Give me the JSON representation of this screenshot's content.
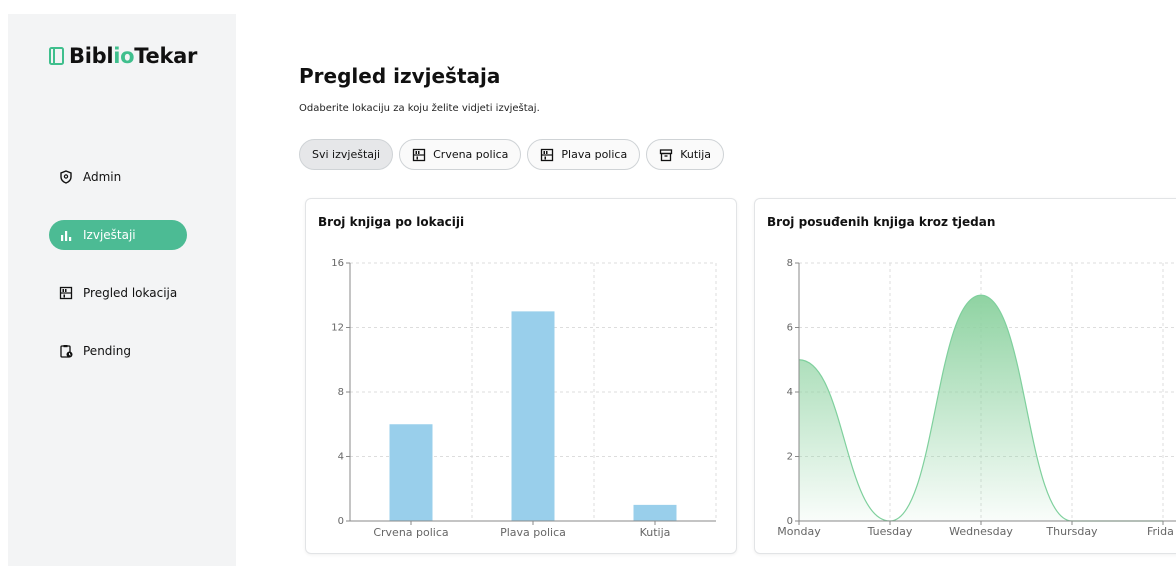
{
  "app": {
    "logo_part1": "Bibl",
    "logo_part2": "io",
    "logo_part3": "Tekar"
  },
  "sidebar": {
    "items": [
      {
        "label": "Admin",
        "icon": "shield-icon",
        "active": false
      },
      {
        "label": "Izvještaji",
        "icon": "bar-chart-icon",
        "active": true
      },
      {
        "label": "Pregled lokacija",
        "icon": "shelf-icon",
        "active": false
      },
      {
        "label": "Pending",
        "icon": "clipboard-clock-icon",
        "active": false
      }
    ]
  },
  "main": {
    "title": "Pregled izvještaja",
    "subtitle": "Odaberite lokaciju za koju želite vidjeti izvještaj.",
    "filters": [
      {
        "label": "Svi izvještaji",
        "icon": "",
        "active": true
      },
      {
        "label": "Crvena polica",
        "icon": "shelf-icon",
        "active": false
      },
      {
        "label": "Plava polica",
        "icon": "shelf-icon",
        "active": false
      },
      {
        "label": "Kutija",
        "icon": "box-icon",
        "active": false
      }
    ]
  },
  "colors": {
    "accent": "#4cbb94",
    "bar": "#99cfeb",
    "area_line": "#7fd09d",
    "area_fill": "#8fd3a2"
  },
  "chart_data": [
    {
      "type": "bar",
      "title": "Broj knjiga po lokaciji",
      "categories": [
        "Crvena polica",
        "Plava polica",
        "Kutija"
      ],
      "values": [
        6,
        13,
        1
      ],
      "ylim": [
        0,
        16
      ],
      "yticks": [
        0,
        4,
        8,
        12,
        16
      ],
      "grid": true
    },
    {
      "type": "area",
      "title": "Broj posuđenih knjiga kroz tjedan",
      "categories": [
        "Monday",
        "Tuesday",
        "Wednesday",
        "Thursday",
        "Frida"
      ],
      "values": [
        5,
        0,
        7,
        0,
        0
      ],
      "ylim": [
        0,
        8
      ],
      "yticks": [
        0,
        2,
        4,
        6,
        8
      ],
      "grid": true
    }
  ]
}
